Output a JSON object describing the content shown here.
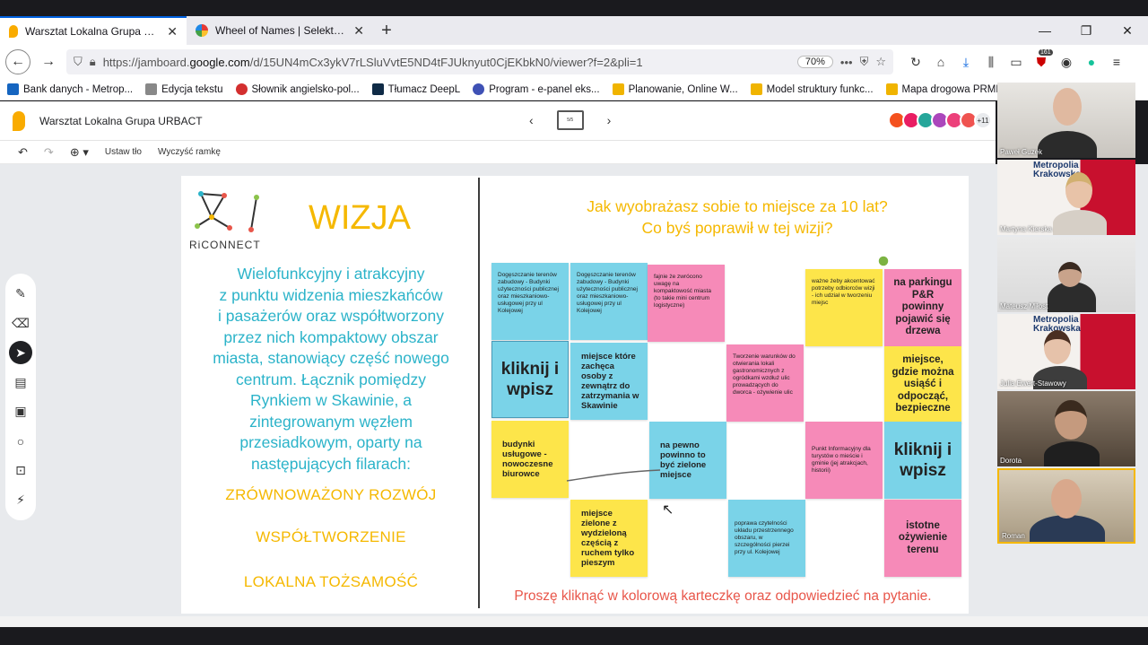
{
  "browser": {
    "tabs": [
      {
        "title": "Warsztat Lokalna Grupa URBACT",
        "active": true
      },
      {
        "title": "Wheel of Names | Selektor nazw",
        "active": false
      }
    ],
    "new_tab": "+",
    "url_prefix": "https://jamboard.",
    "url_domain": "google.com",
    "url_rest": "/d/15UN4mCx3ykV7rLSluVvtE5ND4tFJUknyut0CjEKbkN0/viewer?f=2&pli=1",
    "zoom": "70%",
    "badge_count": "161",
    "bookmarks": [
      "Bank danych - Metrop...",
      "Edycja tekstu",
      "Słownik angielsko-pol...",
      "Tłumacz DeepL",
      "Program - e-panel eks...",
      "Planowanie, Online W...",
      "Model struktury funkc...",
      "Mapa drogowa PRMK..."
    ]
  },
  "app": {
    "title": "Warsztat Lokalna Grupa URBACT",
    "frame_indicator": "5/5",
    "more_participants": "+11",
    "toolbar": {
      "set_background": "Ustaw tło",
      "clear_frame": "Wyczyść ramkę"
    }
  },
  "board": {
    "logo_text": "RiCONNECT",
    "heading": "WIZJA",
    "vision_lines": [
      "Wielofunkcyjny i atrakcyjny",
      "z punktu widzenia mieszkańców",
      "i pasażerów oraz współtworzony",
      "przez nich kompaktowy obszar",
      "miasta, stanowiący część nowego",
      "centrum. Łącznik pomiędzy",
      "Rynkiem w Skawinie, a",
      "zintegrowanym węzłem",
      "przesiadkowym, oparty na",
      "następujących filarach:"
    ],
    "pillars": [
      "ZRÓWNOWAŻONY ROZWÓJ",
      "WSPÓŁTWORZENIE",
      "LOKALNA TOŻSAMOŚĆ"
    ],
    "question_line1": "Jak wyobrażasz sobie to miejsce za 10 lat?",
    "question_line2": "Co byś poprawił w tej wizji?",
    "footnote": "Proszę kliknąć w kolorową karteczkę oraz odpowiedzieć na pytanie.",
    "notes": [
      {
        "text": "Dogęszczanie terenów zabudowy - Budynki użyteczności publicznej oraz mieszkaniowo-usługowej przy ul Kolejowej",
        "color": "blue",
        "size": "small"
      },
      {
        "text": "Dogęszczanie terenów zabudowy - Budynki użyteczności publicznej oraz mieszkaniowo-usługowej przy ul Kolejowej",
        "color": "blue",
        "size": "small"
      },
      {
        "text": "fajnie że zwrócono uwagę na kompaktowość miasta (to takie mini centrum logistyczne)",
        "color": "pink",
        "size": "small"
      },
      {
        "text": "ważne żeby akcentować potrzeby odbiorców wizji - ich udział w tworzeniu miejsc",
        "color": "yellow",
        "size": "small"
      },
      {
        "text": "na parkingu P&R powinny pojawić się drzewa",
        "color": "pink",
        "size": "mid2"
      },
      {
        "text": "kliknij i wpisz",
        "color": "blue",
        "size": "big"
      },
      {
        "text": "miejsce które zachęca osoby z zewnątrz do zatrzymania w Skawinie",
        "color": "blue",
        "size": "medium"
      },
      {
        "text": "Tworzenie warunków do otwierania lokali gastronomicznych z ogródkami wzdłuż ulic prowadzących do dworca - ożywienie ulic",
        "color": "pink",
        "size": "small"
      },
      {
        "text": "miejsce, gdzie można usiąść i odpocząć, bezpieczne",
        "color": "yellow",
        "size": "mid2"
      },
      {
        "text": "budynki usługowe - nowoczesne biurowce",
        "color": "yellow",
        "size": "medium"
      },
      {
        "text": "na pewno powinno to być zielone miejsce",
        "color": "blue",
        "size": "medium"
      },
      {
        "text": "Punkt Informacyjny dla turystów o mieście i gminie (jej atrakcjach, historii)",
        "color": "pink",
        "size": "small"
      },
      {
        "text": "kliknij i wpisz",
        "color": "blue",
        "size": "big"
      },
      {
        "text": "miejsce zielone z wydzieloną częścią z ruchem tylko pieszym",
        "color": "yellow",
        "size": "medium"
      },
      {
        "text": "poprawa czytelności układu przestrzennego obszaru, w szczególności pierzei przy ul. Kolejowej",
        "color": "blue",
        "size": "small"
      },
      {
        "text": "istotne ożywienie terenu",
        "color": "pink",
        "size": "mid2"
      }
    ]
  },
  "participants": [
    {
      "name": "Paweł Guzek"
    },
    {
      "name": "Martyna Kierska",
      "org": "Metropolia Krakowska"
    },
    {
      "name": "Mateusz Miłost"
    },
    {
      "name": "Julia Ewert-Stawowy",
      "org": "Metropolia Krakowska"
    },
    {
      "name": "Dorota"
    },
    {
      "name": "Roman"
    }
  ],
  "colors": {
    "note_blue": "#7ad3e8",
    "note_yellow": "#fde54a",
    "note_pink": "#f68ab8",
    "vision_text": "#2bb3c9",
    "heading": "#f5b800",
    "footnote": "#e8564a",
    "metropolia_red": "#c8102e"
  }
}
